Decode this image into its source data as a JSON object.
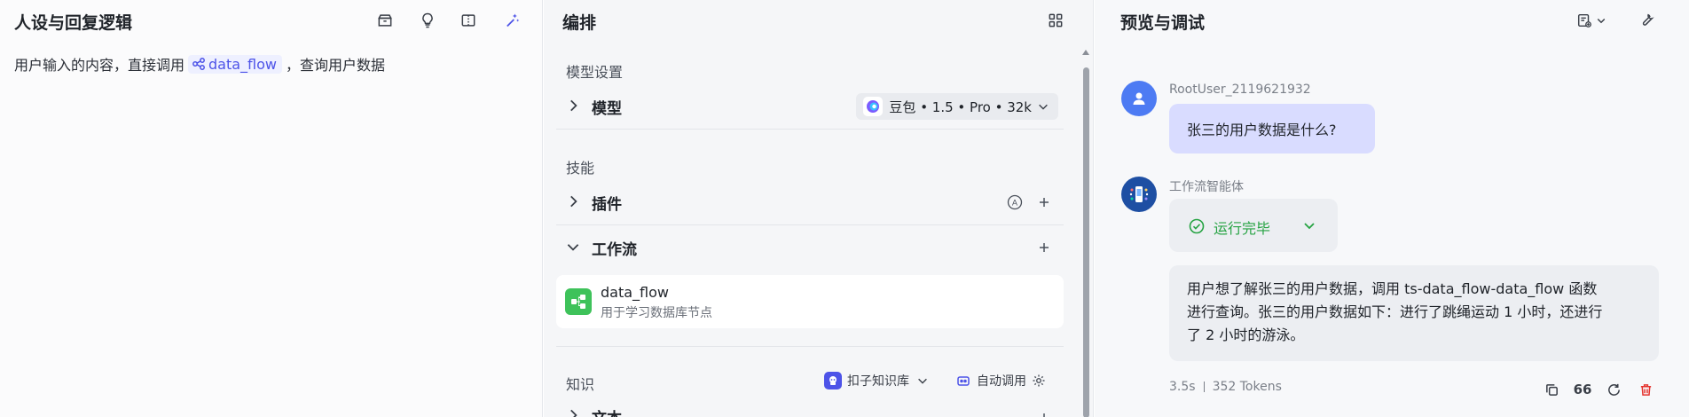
{
  "left_panel": {
    "title": "人设与回复逻辑",
    "prompt": {
      "before": "用户输入的内容，直接调用",
      "chip": "data_flow",
      "after": "，查询用户数据"
    }
  },
  "middle_panel": {
    "title": "编排",
    "model_section": {
      "label": "模型设置",
      "row_title": "模型",
      "model_name": "豆包 • 1.5 • Pro • 32k"
    },
    "skills_section": {
      "label": "技能",
      "plugins_title": "插件",
      "workflow_title": "工作流",
      "workflow_item": {
        "name": "data_flow",
        "description": "用于学习数据库节点"
      }
    },
    "knowledge_section": {
      "label": "知识",
      "kb_source": "扣子知识库",
      "auto_call": "自动调用",
      "next_row_partial": "文本"
    }
  },
  "right_panel": {
    "title": "预览与调试",
    "messages": {
      "user_name": "RootUser_2119621932",
      "user_text": "张三的用户数据是什么?",
      "bot_name": "工作流智能体",
      "status_text": "运行完毕",
      "bot_line1": "用户想了解张三的用户数据，调用 ts-data_flow-data_flow 函数",
      "bot_line2": "进行查询。张三的用户数据如下：进行了跳绳运动 1 小时，还进行",
      "bot_line3": "了 2 小时的游泳。",
      "duration": "3.5s",
      "tokens": "352 Tokens",
      "quote_glyph": "66"
    }
  },
  "colors": {
    "accent": "#4d53e8",
    "success": "#26a343",
    "danger": "#e5342f",
    "user_bubble": "#d9dcff"
  }
}
